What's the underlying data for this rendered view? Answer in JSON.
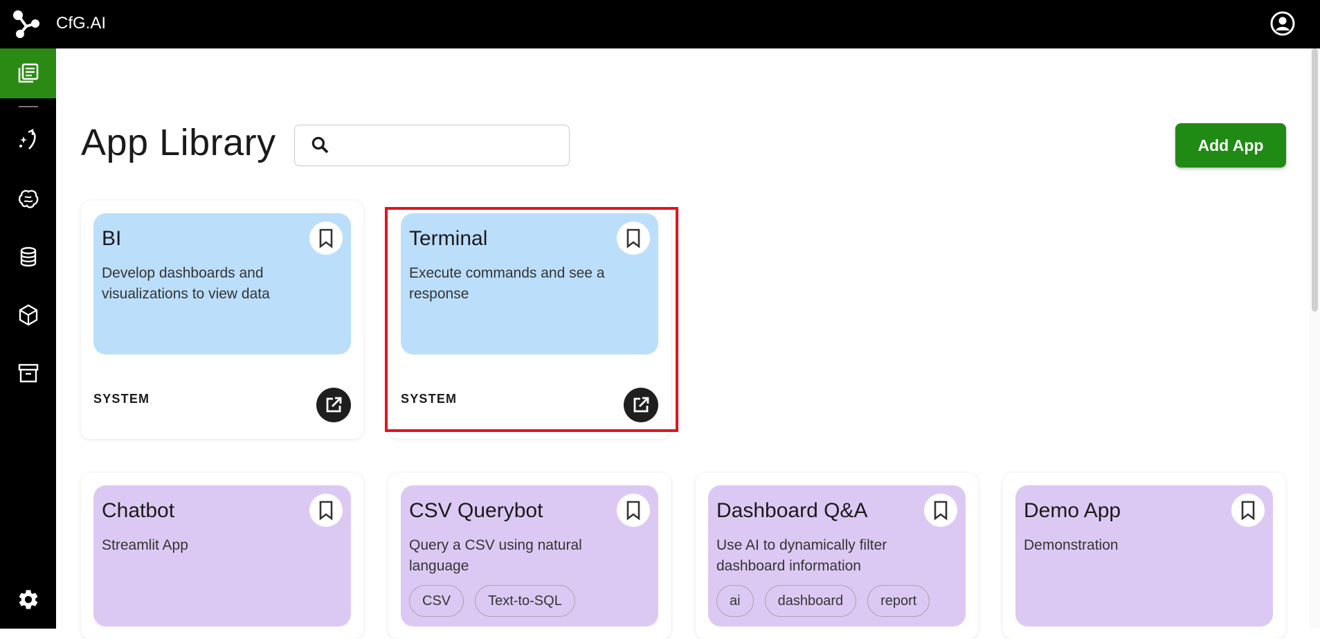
{
  "header": {
    "app_title": "CfG.AI"
  },
  "sidebar": {
    "items": [
      {
        "icon": "library-icon",
        "active": true
      },
      {
        "icon": "sparkle-arrow-icon"
      },
      {
        "icon": "brain-icon"
      },
      {
        "icon": "database-icon"
      },
      {
        "icon": "cube-icon"
      },
      {
        "icon": "archive-icon"
      },
      {
        "icon": "gear-icon"
      }
    ]
  },
  "main": {
    "title": "App Library",
    "search": {
      "placeholder": "",
      "value": ""
    },
    "add_button_label": "Add App"
  },
  "cards": [
    {
      "name": "BI",
      "description": "Develop dashboards and visualizations to view data",
      "owner": "SYSTEM",
      "color": "#bbdefb"
    },
    {
      "name": "Terminal",
      "description": "Execute commands and see a response",
      "owner": "SYSTEM",
      "color": "#bbdefb",
      "highlighted": true
    },
    {
      "name": "Chatbot",
      "description": "Streamlit App",
      "tags": [],
      "color": "#dcc9f3"
    },
    {
      "name": "CSV Querybot",
      "description": "Query a CSV using natural language",
      "tags": [
        "CSV",
        "Text-to-SQL"
      ],
      "color": "#dcc9f3"
    },
    {
      "name": "Dashboard Q&A",
      "description": "Use AI to dynamically filter dashboard information",
      "tags": [
        "ai",
        "dashboard",
        "report"
      ],
      "color": "#dcc9f3"
    },
    {
      "name": "Demo App",
      "description": "Demonstration",
      "tags": [],
      "color": "#dcc9f3"
    }
  ],
  "colors": {
    "accent": "#1f8a14",
    "highlight": "#e0151f"
  }
}
